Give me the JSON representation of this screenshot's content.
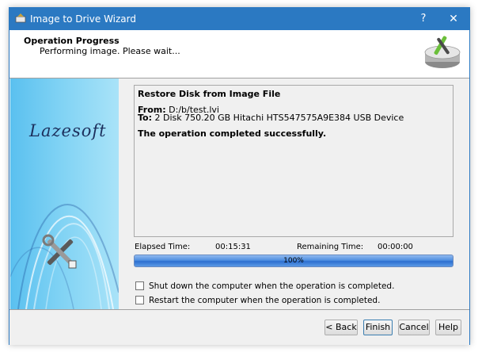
{
  "window": {
    "title": "Image to Drive Wizard",
    "help_label": "?",
    "close_label": "✕"
  },
  "header": {
    "title": "Operation Progress",
    "subtitle": "Performing image. Please wait..."
  },
  "sidebar": {
    "brand": "Lazesoft"
  },
  "log": {
    "heading": "Restore Disk from Image File",
    "from_label": "From:",
    "from_value": " D:/b/test.lvi",
    "to_label": "To:",
    "to_value": " 2 Disk 750.20 GB Hitachi HTS547575A9E384 USB Device",
    "result": "The operation completed successfully."
  },
  "timing": {
    "elapsed_label": "Elapsed Time:",
    "elapsed_value": "00:15:31",
    "remaining_label": "Remaining Time:",
    "remaining_value": "00:00:00"
  },
  "progress": {
    "percent_text": "100%",
    "value": 100
  },
  "options": {
    "shutdown_label": "Shut down the computer when the operation is completed.",
    "shutdown_checked": false,
    "restart_label": "Restart the computer when the operation is completed.",
    "restart_checked": false
  },
  "buttons": {
    "back": "< Back",
    "finish": "Finish",
    "cancel": "Cancel",
    "help": "Help"
  },
  "colors": {
    "titlebar": "#2b79c2",
    "sidebar_start": "#5ac0ef",
    "progress": "#2d6fd0"
  }
}
